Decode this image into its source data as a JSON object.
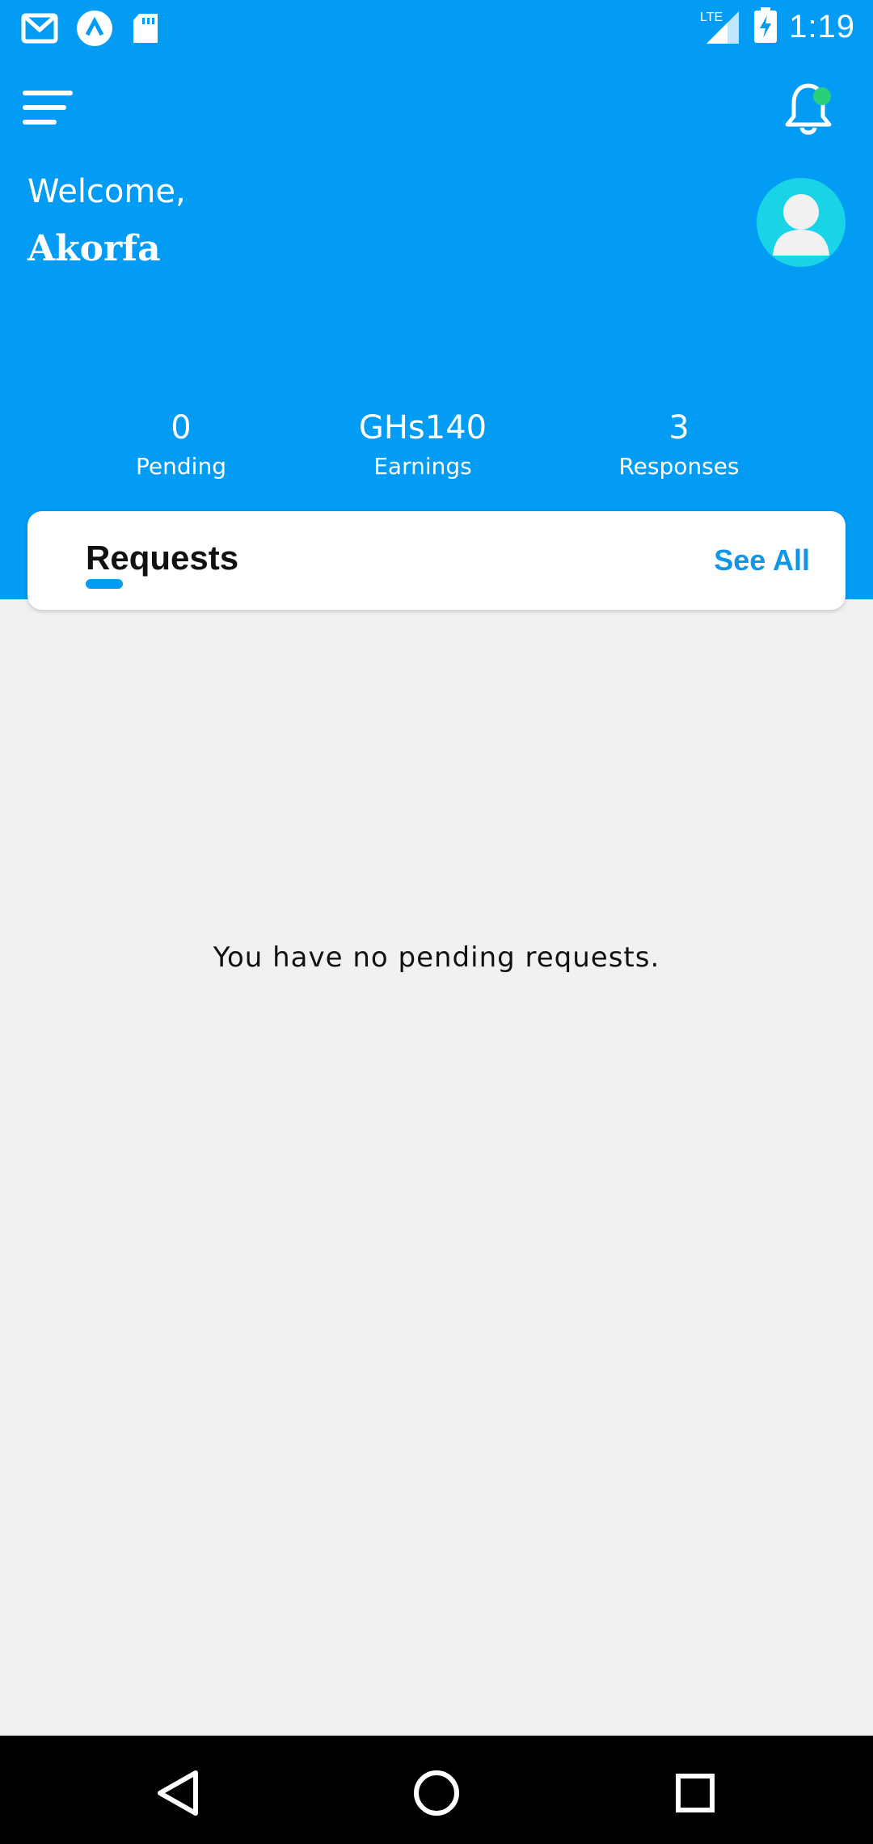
{
  "status_bar": {
    "time": "1:19",
    "network": "LTE",
    "icons": [
      "gmail-icon",
      "app-icon",
      "sd-card-icon",
      "signal-icon",
      "battery-charging-icon"
    ]
  },
  "header": {
    "menu_icon": "hamburger-menu-icon",
    "notification_icon": "bell-icon",
    "notification_dot_color": "#28d07a",
    "welcome": "Welcome,",
    "username": "Akorfa"
  },
  "stats": [
    {
      "value": "0",
      "label": "Pending"
    },
    {
      "value": "GHs140",
      "label": "Earnings"
    },
    {
      "value": "3",
      "label": "Responses"
    }
  ],
  "requests_card": {
    "title": "Requests",
    "see_all": "See All"
  },
  "empty_state": {
    "message": "You have no pending requests."
  },
  "navbar": {
    "icons": [
      "back-icon",
      "home-icon",
      "recents-icon"
    ]
  },
  "colors": {
    "primary": "#039cf4",
    "background": "#f1f1f1",
    "accent_text": "#1296e8"
  }
}
